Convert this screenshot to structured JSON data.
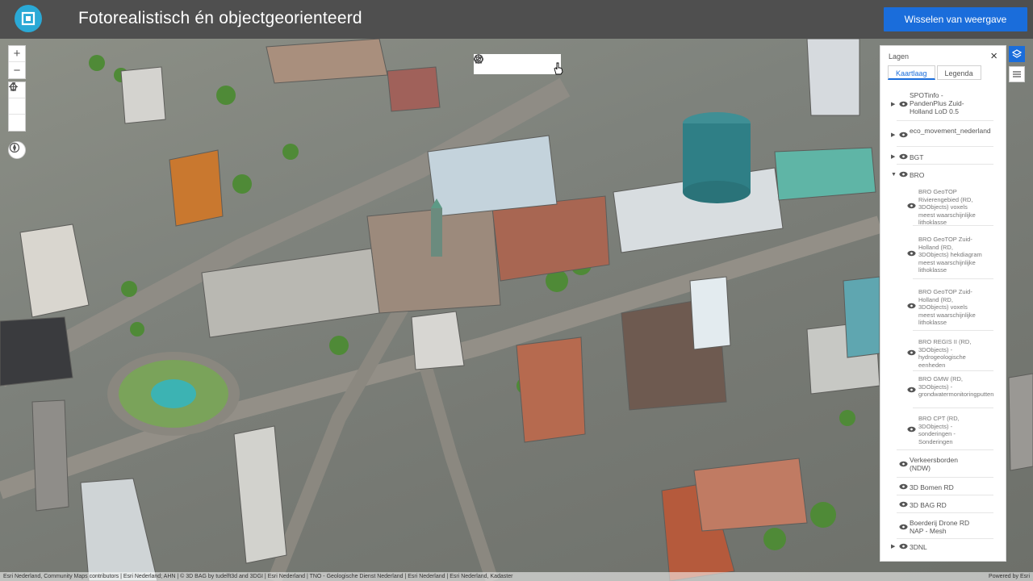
{
  "header": {
    "title": "Fotorealistisch én objectgeorienteerd",
    "switch_button": "Wisselen van weergave",
    "logo_icon": "app-logo-icon",
    "bg_color": "#4f4f4f",
    "accent_color": "#1a6ddb"
  },
  "navigation": {
    "zoom_in": "+",
    "zoom_out": "−",
    "home_icon": "home-icon",
    "pan_icon": "pan-icon",
    "rotate_icon": "rotate-icon",
    "compass_icon": "compass-icon"
  },
  "toolbar": {
    "items": [
      "sun-icon",
      "weather-icon",
      "elevation-icon",
      "measure-icon",
      "lineofsight-icon"
    ]
  },
  "layer_panel": {
    "title": "Lagen",
    "close": "×",
    "tabs": [
      {
        "label": "Kaartlaag",
        "active": true
      },
      {
        "label": "Legenda",
        "active": false
      }
    ],
    "layers": [
      {
        "name": "SPOTinfo - PandenPlus Zuid-Holland LoD 0.5",
        "expand": "▶"
      },
      {
        "name": "eco_movement_nederland",
        "expand": "▶"
      },
      {
        "name": "BGT",
        "expand": "▶"
      },
      {
        "name": "BRO",
        "expand": "▼"
      },
      {
        "name": "BRO GeoTOP Rivierengebied (RD, 3DObjects) voxels meest waarschijnlijke lithoklasse",
        "sub": true
      },
      {
        "name": "BRO GeoTOP Zuid-Holland (RD, 3DObjects) hekdiagram meest waarschijnlijke lithoklasse",
        "sub": true
      },
      {
        "name": "BRO GeoTOP Zuid-Holland (RD, 3DObjects) voxels meest waarschijnlijke lithoklasse",
        "sub": true
      },
      {
        "name": "BRO REGIS II (RD, 3DObjects) - hydrogeologische eenheden",
        "sub": true
      },
      {
        "name": "BRO GMW (RD, 3DObjects) - grondwatermonitoringputten",
        "sub": true
      },
      {
        "name": "BRO CPT (RD, 3DObjects) - sonderingen - Sonderingen",
        "sub": true
      },
      {
        "name": "Verkeersborden (NDW)",
        "expand": ""
      },
      {
        "name": "3D Bomen RD",
        "expand": ""
      },
      {
        "name": "3D BAG RD",
        "expand": ""
      },
      {
        "name": "Boerderij Drone RD NAP - Mesh",
        "expand": ""
      },
      {
        "name": "3DNL",
        "expand": "▶"
      }
    ]
  },
  "side_buttons": {
    "layers_icon": "layers-icon",
    "legend_icon": "legend-icon"
  },
  "attribution": {
    "text": "Esri Nederland, Community Maps contributors | Esri Nederland; AHN | © 3D BAG by tudelft3d and 3DGI | Esri Nederland | TNO - Geologische Dienst Nederland | Esri Nederland | Esri Nederland, Kadaster",
    "powered": "Powered by Esri"
  }
}
